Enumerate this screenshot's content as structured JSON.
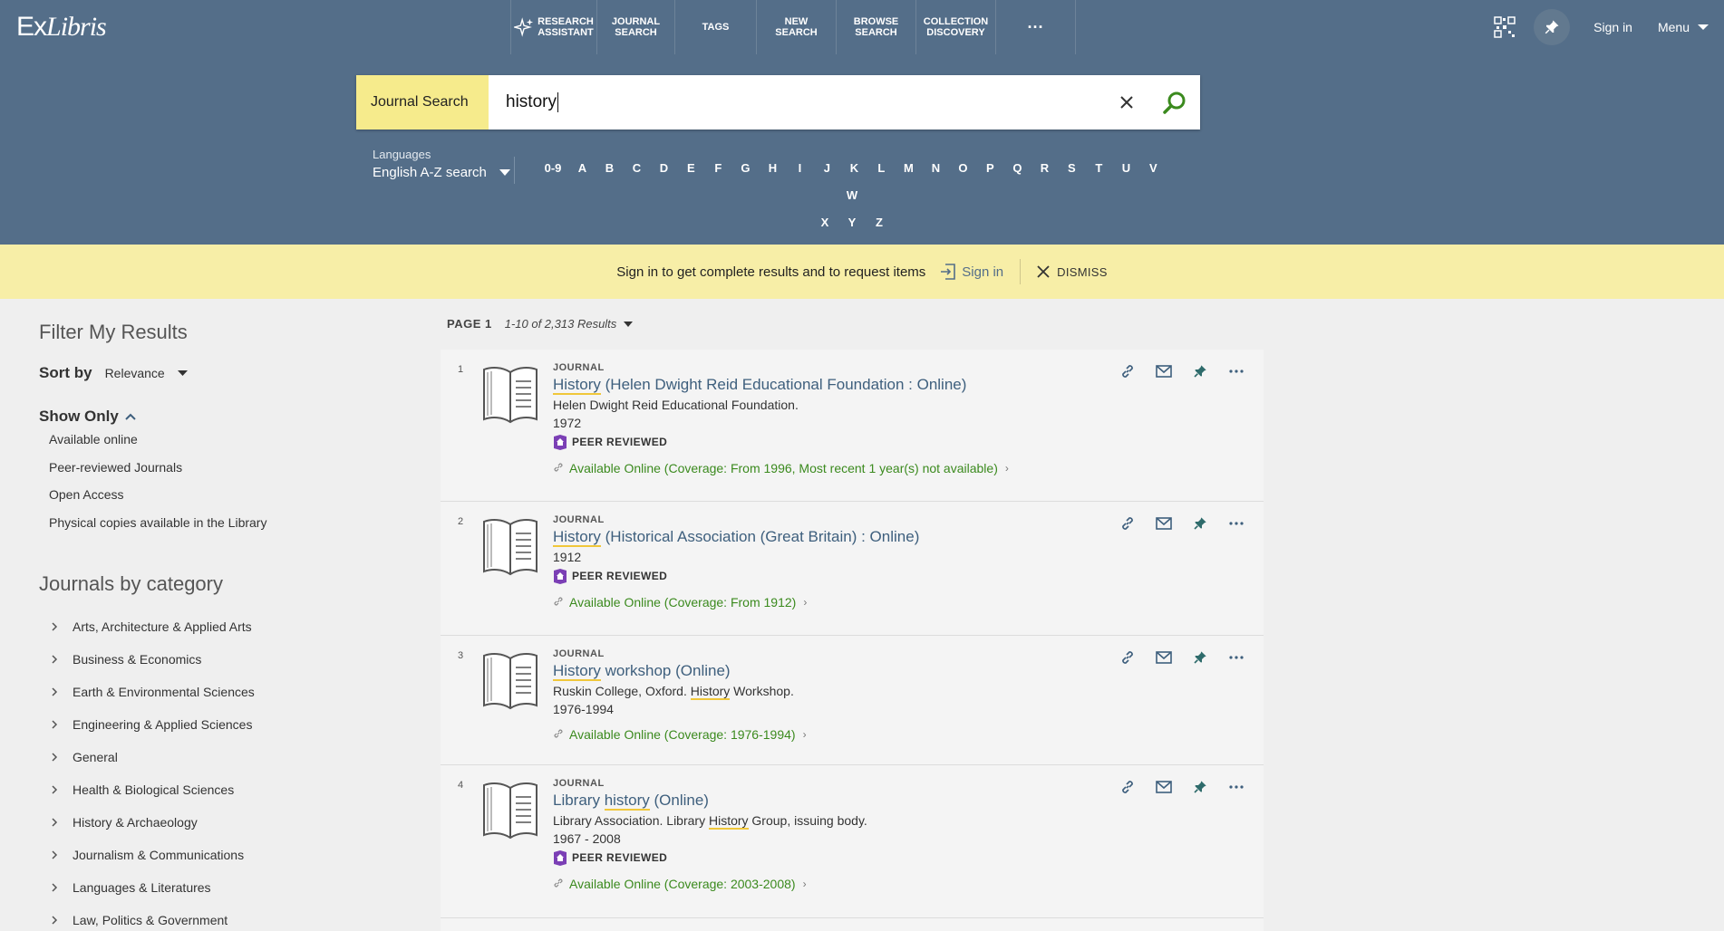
{
  "brand": {
    "logo_text_a": "Ex",
    "logo_text_b": "Libris"
  },
  "nav": {
    "items": [
      {
        "label_1": "RESEARCH",
        "label_2": "ASSISTANT"
      },
      {
        "label_1": "JOURNAL",
        "label_2": "SEARCH"
      },
      {
        "label_1": "TAGS",
        "label_2": ""
      },
      {
        "label_1": "NEW SEARCH",
        "label_2": ""
      },
      {
        "label_1": "BROWSE",
        "label_2": "SEARCH"
      },
      {
        "label_1": "COLLECTION",
        "label_2": "DISCOVERY"
      }
    ],
    "more": "···",
    "sign_in": "Sign in",
    "menu": "Menu"
  },
  "search": {
    "scope": "Journal Search",
    "query": "history",
    "languages_label": "Languages",
    "languages_value": "English A-Z search",
    "az": [
      "0-9",
      "A",
      "B",
      "C",
      "D",
      "E",
      "F",
      "G",
      "H",
      "I",
      "J",
      "K",
      "L",
      "M",
      "N",
      "O",
      "P",
      "Q",
      "R",
      "S",
      "T",
      "U",
      "V",
      "W",
      "X",
      "Y",
      "Z"
    ]
  },
  "banner": {
    "message": "Sign in to get complete results and to request items",
    "signin": "Sign in",
    "dismiss": "DISMISS"
  },
  "filters": {
    "title": "Filter My Results",
    "sort_label": "Sort by",
    "sort_value": "Relevance",
    "show_only": "Show Only",
    "show_only_items": [
      "Available online",
      "Peer-reviewed Journals",
      "Open Access",
      "Physical copies available in the Library"
    ],
    "categories_title": "Journals by category",
    "categories": [
      "Arts, Architecture & Applied Arts",
      "Business & Economics",
      "Earth & Environmental Sciences",
      "Engineering & Applied Sciences",
      "General",
      "Health & Biological Sciences",
      "History & Archaeology",
      "Journalism & Communications",
      "Languages & Literatures",
      "Law, Politics & Government"
    ]
  },
  "results_header": {
    "page": "PAGE 1",
    "count": "1-10 of 2,313 Results"
  },
  "results": [
    {
      "num": "1",
      "type": "JOURNAL",
      "title_hl": "History",
      "title_rest": " (Helen Dwight Reid Educational Foundation : Online)",
      "author": "Helen Dwight Reid Educational Foundation.",
      "author_pre": "",
      "author_hl": "",
      "author_post": "",
      "year": "1972",
      "peer_reviewed": "PEER REVIEWED",
      "availability": "Available Online (Coverage: From 1996, Most recent 1 year(s) not available)"
    },
    {
      "num": "2",
      "type": "JOURNAL",
      "title_hl": "History",
      "title_rest": " (Historical Association (Great Britain) : Online)",
      "author": "",
      "year": "1912",
      "peer_reviewed": "PEER REVIEWED",
      "availability": "Available Online (Coverage: From 1912)"
    },
    {
      "num": "3",
      "type": "JOURNAL",
      "title_hl": "History",
      "title_rest": " workshop (Online)",
      "author_pre": "Ruskin College, Oxford. ",
      "author_hl": "History",
      "author_post": " Workshop.",
      "year": "1976-1994",
      "peer_reviewed": "",
      "availability": "Available Online (Coverage: 1976-1994)"
    },
    {
      "num": "4",
      "type": "JOURNAL",
      "title_pre": "Library ",
      "title_hl": "history",
      "title_rest": " (Online)",
      "author_pre": "Library Association. Library ",
      "author_hl": "History",
      "author_post": " Group, issuing body.",
      "year": "1967 - 2008",
      "peer_reviewed": "PEER REVIEWED",
      "availability": "Available Online (Coverage: 2003-2008)"
    }
  ],
  "colors": {
    "topbar": "#546e89",
    "banner": "#f7eea7",
    "scope": "#f6eb8c",
    "link": "#3e5f7d",
    "available": "#3b8a1e",
    "highlight": "#f0c73a",
    "peer": "#7b3fb5"
  }
}
